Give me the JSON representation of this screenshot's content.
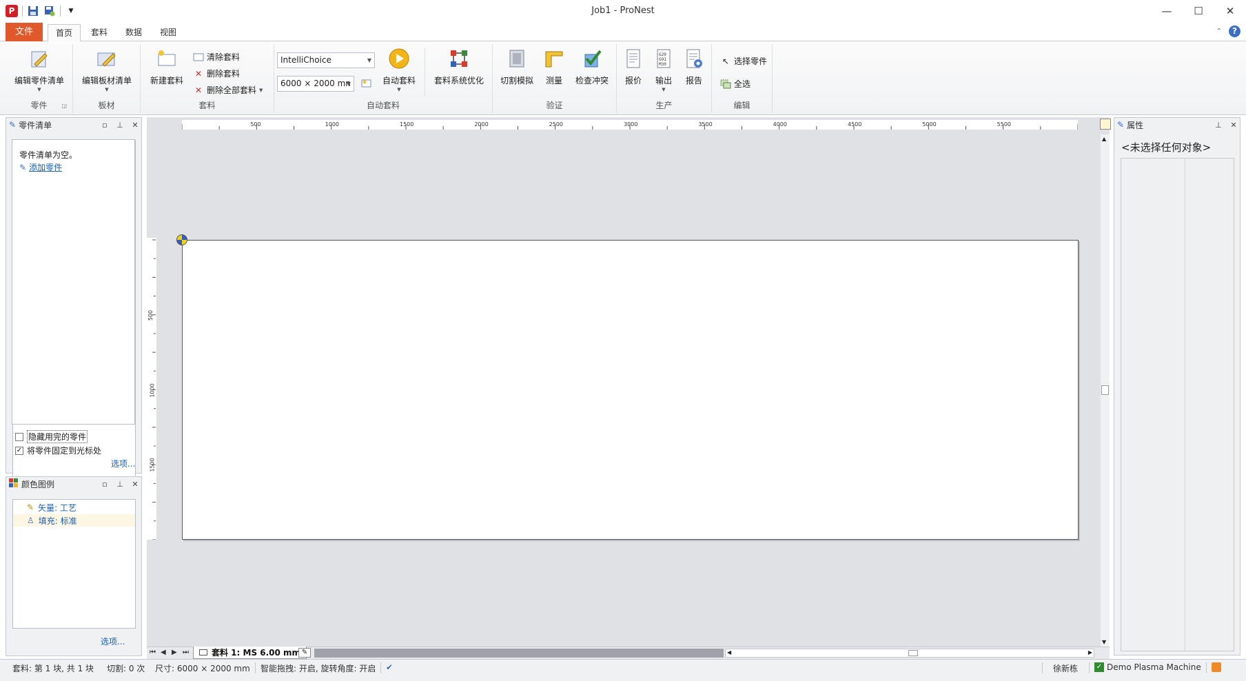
{
  "window": {
    "title": "Job1 - ProNest",
    "logo": "P",
    "minimize": "—",
    "maximize": "☐",
    "close": "✕"
  },
  "ribbon_tabs": {
    "file": "文件",
    "home": "首页",
    "nest": "套料",
    "data": "数据",
    "view": "视图",
    "help": "?"
  },
  "ribbon": {
    "groups": {
      "parts": "零件",
      "plates": "板材",
      "nesting": "套料",
      "auto_nest": "自动套料",
      "verify": "验证",
      "production": "生产",
      "edit": "编辑"
    },
    "buttons": {
      "edit_part_list": "编辑零件清单",
      "edit_plate_list": "编辑板材清单",
      "new_nest": "新建套料",
      "clear_nest": "清除套料",
      "delete_nest": "删除套料",
      "delete_all_nests": "删除全部套料",
      "auto_nest": "自动套料",
      "optimize_nest": "套料系统优化",
      "cut_sim": "切割模拟",
      "measure": "测量",
      "check_collision": "检查冲突",
      "quote": "报价",
      "output": "输出",
      "report": "报告",
      "select_part": "选择零件",
      "select_all": "全选"
    },
    "combo_strategy": "IntelliChoice",
    "combo_plate_size": "6000 × 2000 mn"
  },
  "part_list_panel": {
    "title": "零件清单",
    "empty_text": "零件清单为空。",
    "add_part": "添加零件",
    "hide_used": "隐藏用完的零件",
    "fix_to_cursor": "将零件固定到光标处",
    "fix_checked": "✓",
    "options": "选项..."
  },
  "color_legend_panel": {
    "title": "颜色图例",
    "vector": "矢量: 工艺",
    "fill": "填充: 标准",
    "options": "选项..."
  },
  "properties_panel": {
    "title": "属性",
    "no_selection": "<未选择任何对象>"
  },
  "ruler": {
    "horizontal": [
      "500",
      "1000",
      "1500",
      "2000",
      "2500",
      "3000",
      "3500",
      "4000",
      "4500",
      "5000",
      "5500"
    ],
    "vertical": [
      "500",
      "1000",
      "1500"
    ]
  },
  "nest_tab": {
    "label": "套料 1: MS 6.00 mm"
  },
  "status_bar": {
    "nest_info": "套料: 第 1 块, 共 1 块",
    "cut_count": "切割: 0 次",
    "size": "尺寸:  6000 × 2000 mm",
    "smart_drag": "智能拖拽: 开启, 旋转角度: 开启",
    "user": "徐新栋",
    "machine": "Demo Plasma Machine"
  },
  "colors": {
    "file_tab": "#e0592a",
    "link": "#1a5fb4",
    "workspace": "#dfe1e5",
    "logo": "#d31f26"
  }
}
